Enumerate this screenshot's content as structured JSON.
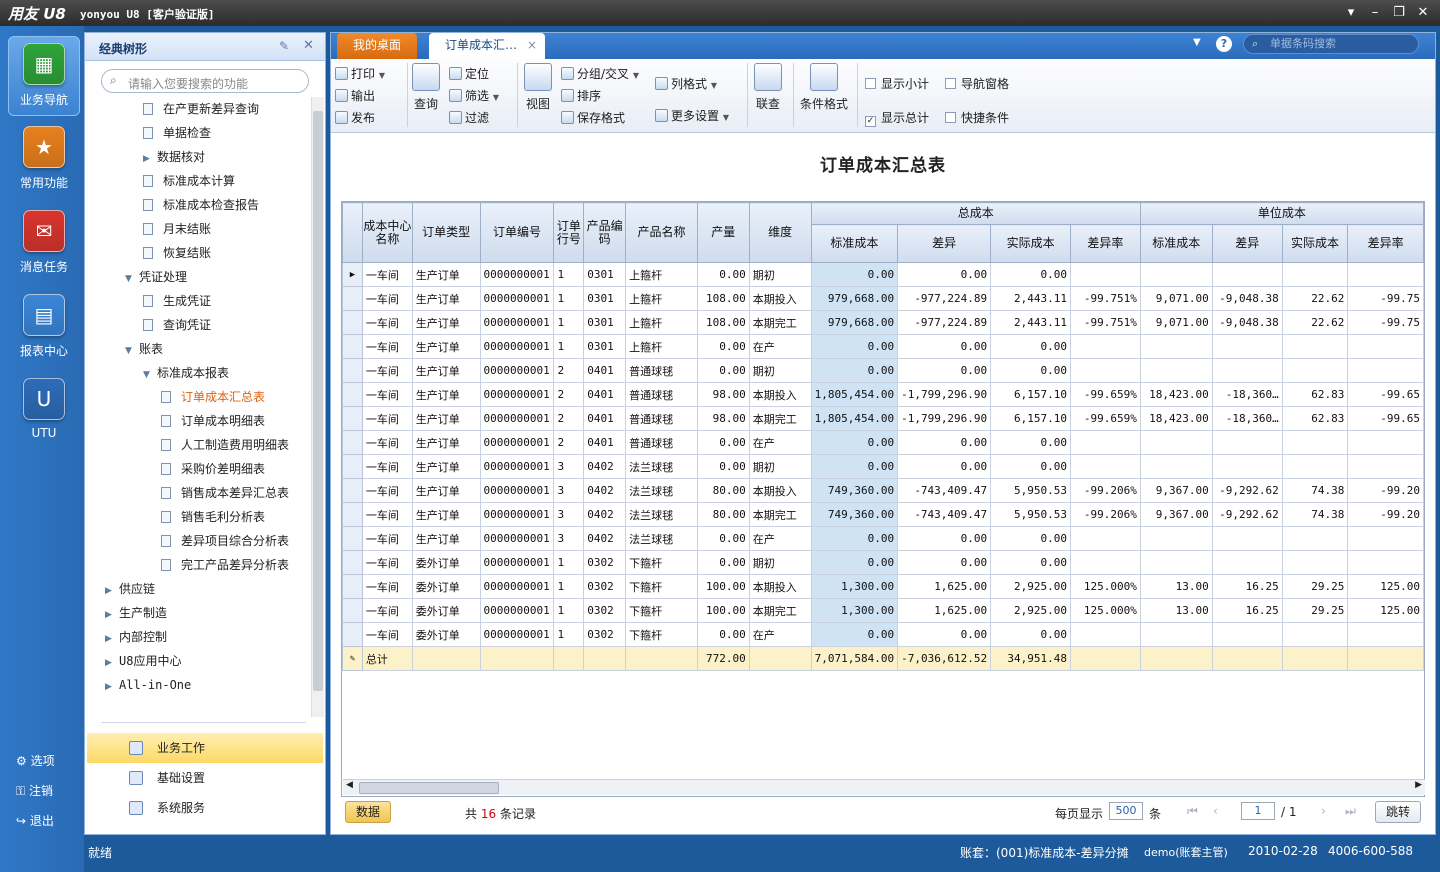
{
  "app": {
    "logo": "用友 U8",
    "title": "yonyou U8 [客户验证版]"
  },
  "modules": [
    {
      "label": "业务导航",
      "color": "#2fa33a"
    },
    {
      "label": "常用功能",
      "color": "#e7801f"
    },
    {
      "label": "消息任务",
      "color": "#d8352e"
    },
    {
      "label": "报表中心",
      "color": "#3a86d8"
    },
    {
      "label": "UTU",
      "color": "#2e6cb8"
    }
  ],
  "bottom_links": [
    {
      "label": "选项"
    },
    {
      "label": "注销"
    },
    {
      "label": "退出"
    }
  ],
  "nav": {
    "title": "经典树形",
    "search_placeholder": "请输入您要搜索的功能",
    "tree": [
      {
        "label": "在产更新差异查询",
        "kind": "doc",
        "level": 2
      },
      {
        "label": "单据检查",
        "kind": "doc",
        "level": 2
      },
      {
        "label": "数据核对",
        "kind": "folder",
        "level": 2,
        "arrow": "›"
      },
      {
        "label": "标准成本计算",
        "kind": "doc",
        "level": 2
      },
      {
        "label": "标准成本检查报告",
        "kind": "doc",
        "level": 2
      },
      {
        "label": "月末结账",
        "kind": "doc",
        "level": 2
      },
      {
        "label": "恢复结账",
        "kind": "doc",
        "level": 2
      },
      {
        "label": "凭证处理",
        "kind": "folder",
        "level": 1,
        "arrow": "⌄"
      },
      {
        "label": "生成凭证",
        "kind": "doc",
        "level": 2
      },
      {
        "label": "查询凭证",
        "kind": "doc",
        "level": 2
      },
      {
        "label": "账表",
        "kind": "folder",
        "level": 1,
        "arrow": "⌄"
      },
      {
        "label": "标准成本报表",
        "kind": "folder",
        "level": 2,
        "arrow": "⌄"
      },
      {
        "label": "订单成本汇总表",
        "kind": "doc",
        "level": 3,
        "active": true
      },
      {
        "label": "订单成本明细表",
        "kind": "doc",
        "level": 3
      },
      {
        "label": "人工制造费用明细表",
        "kind": "doc",
        "level": 3
      },
      {
        "label": "采购价差明细表",
        "kind": "doc",
        "level": 3
      },
      {
        "label": "销售成本差异汇总表",
        "kind": "doc",
        "level": 3
      },
      {
        "label": "销售毛利分析表",
        "kind": "doc",
        "level": 3
      },
      {
        "label": "差异项目综合分析表",
        "kind": "doc",
        "level": 3
      },
      {
        "label": "完工产品差异分析表",
        "kind": "doc",
        "level": 3
      },
      {
        "label": "供应链",
        "kind": "folder",
        "level": 0,
        "arrow": "›"
      },
      {
        "label": "生产制造",
        "kind": "folder",
        "level": 0,
        "arrow": "›"
      },
      {
        "label": "内部控制",
        "kind": "folder",
        "level": 0,
        "arrow": "›"
      },
      {
        "label": "U8应用中心",
        "kind": "folder",
        "level": 0,
        "arrow": "›"
      },
      {
        "label": "All-in-One",
        "kind": "folder",
        "level": 0,
        "arrow": "›"
      }
    ],
    "sections": [
      {
        "label": "业务工作",
        "selected": true
      },
      {
        "label": "基础设置",
        "selected": false
      },
      {
        "label": "系统服务",
        "selected": false
      }
    ]
  },
  "tabs": {
    "desktop": "我的桌面",
    "current": "订单成本汇…",
    "barcode_placeholder": "单据条码搜索"
  },
  "toolbar": {
    "print": "打印",
    "export": "输出",
    "publish": "发布",
    "query": "查询",
    "locate": "定位",
    "filter": "筛选",
    "filter2": "过滤",
    "view": "视图",
    "group": "分组/交叉",
    "sort": "排序",
    "save_format": "保存格式",
    "col_format": "列格式",
    "more_settings": "更多设置",
    "linked_query": "联查",
    "cond_format": "条件格式",
    "show_subtotal": "显示小计",
    "show_total": "显示总计",
    "nav_pane": "导航窗格",
    "quick_cond": "快捷条件",
    "show_subtotal_checked": false,
    "show_total_checked": true,
    "nav_pane_checked": false,
    "quick_cond_checked": false
  },
  "report": {
    "title": "订单成本汇总表",
    "group_headers": {
      "total_cost": "总成本",
      "unit_cost": "单位成本"
    },
    "columns": [
      "成本中心名称",
      "订单类型",
      "订单编号",
      "订单行号",
      "产品编码",
      "产品名称",
      "产量",
      "维度",
      "标准成本",
      "差异",
      "实际成本",
      "差异率",
      "标准成本",
      "差异",
      "实际成本",
      "差异率"
    ],
    "rows": [
      [
        "一车间",
        "生产订单",
        "0000000001",
        "1",
        "0301",
        "上箍杆",
        "0.00",
        "期初",
        "0.00",
        "0.00",
        "0.00",
        "",
        "",
        "",
        "",
        ""
      ],
      [
        "一车间",
        "生产订单",
        "0000000001",
        "1",
        "0301",
        "上箍杆",
        "108.00",
        "本期投入",
        "979,668.00",
        "-977,224.89",
        "2,443.11",
        "-99.751%",
        "9,071.00",
        "-9,048.38",
        "22.62",
        "-99.75"
      ],
      [
        "一车间",
        "生产订单",
        "0000000001",
        "1",
        "0301",
        "上箍杆",
        "108.00",
        "本期完工",
        "979,668.00",
        "-977,224.89",
        "2,443.11",
        "-99.751%",
        "9,071.00",
        "-9,048.38",
        "22.62",
        "-99.75"
      ],
      [
        "一车间",
        "生产订单",
        "0000000001",
        "1",
        "0301",
        "上箍杆",
        "0.00",
        "在产",
        "0.00",
        "0.00",
        "0.00",
        "",
        "",
        "",
        "",
        ""
      ],
      [
        "一车间",
        "生产订单",
        "0000000001",
        "2",
        "0401",
        "普通球毬",
        "0.00",
        "期初",
        "0.00",
        "0.00",
        "0.00",
        "",
        "",
        "",
        "",
        ""
      ],
      [
        "一车间",
        "生产订单",
        "0000000001",
        "2",
        "0401",
        "普通球毬",
        "98.00",
        "本期投入",
        "1,805,454.00",
        "-1,799,296.90",
        "6,157.10",
        "-99.659%",
        "18,423.00",
        "-18,360…",
        "62.83",
        "-99.65"
      ],
      [
        "一车间",
        "生产订单",
        "0000000001",
        "2",
        "0401",
        "普通球毬",
        "98.00",
        "本期完工",
        "1,805,454.00",
        "-1,799,296.90",
        "6,157.10",
        "-99.659%",
        "18,423.00",
        "-18,360…",
        "62.83",
        "-99.65"
      ],
      [
        "一车间",
        "生产订单",
        "0000000001",
        "2",
        "0401",
        "普通球毬",
        "0.00",
        "在产",
        "0.00",
        "0.00",
        "0.00",
        "",
        "",
        "",
        "",
        ""
      ],
      [
        "一车间",
        "生产订单",
        "0000000001",
        "3",
        "0402",
        "法兰球毬",
        "0.00",
        "期初",
        "0.00",
        "0.00",
        "0.00",
        "",
        "",
        "",
        "",
        ""
      ],
      [
        "一车间",
        "生产订单",
        "0000000001",
        "3",
        "0402",
        "法兰球毬",
        "80.00",
        "本期投入",
        "749,360.00",
        "-743,409.47",
        "5,950.53",
        "-99.206%",
        "9,367.00",
        "-9,292.62",
        "74.38",
        "-99.20"
      ],
      [
        "一车间",
        "生产订单",
        "0000000001",
        "3",
        "0402",
        "法兰球毬",
        "80.00",
        "本期完工",
        "749,360.00",
        "-743,409.47",
        "5,950.53",
        "-99.206%",
        "9,367.00",
        "-9,292.62",
        "74.38",
        "-99.20"
      ],
      [
        "一车间",
        "生产订单",
        "0000000001",
        "3",
        "0402",
        "法兰球毬",
        "0.00",
        "在产",
        "0.00",
        "0.00",
        "0.00",
        "",
        "",
        "",
        "",
        ""
      ],
      [
        "一车间",
        "委外订单",
        "0000000001",
        "1",
        "0302",
        "下箍杆",
        "0.00",
        "期初",
        "0.00",
        "0.00",
        "0.00",
        "",
        "",
        "",
        "",
        ""
      ],
      [
        "一车间",
        "委外订单",
        "0000000001",
        "1",
        "0302",
        "下箍杆",
        "100.00",
        "本期投入",
        "1,300.00",
        "1,625.00",
        "2,925.00",
        "125.000%",
        "13.00",
        "16.25",
        "29.25",
        "125.00"
      ],
      [
        "一车间",
        "委外订单",
        "0000000001",
        "1",
        "0302",
        "下箍杆",
        "100.00",
        "本期完工",
        "1,300.00",
        "1,625.00",
        "2,925.00",
        "125.000%",
        "13.00",
        "16.25",
        "29.25",
        "125.00"
      ],
      [
        "一车间",
        "委外订单",
        "0000000001",
        "1",
        "0302",
        "下箍杆",
        "0.00",
        "在产",
        "0.00",
        "0.00",
        "0.00",
        "",
        "",
        "",
        "",
        ""
      ]
    ],
    "total_row": [
      "总计",
      "",
      "",
      "",
      "",
      "",
      "772.00",
      "",
      "7,071,584.00",
      "-7,036,612.52",
      "34,951.48",
      "",
      "",
      "",
      "",
      ""
    ]
  },
  "pager": {
    "data_btn": "数据",
    "count_prefix": "共",
    "count": "16",
    "count_suffix": "条记录",
    "per_page_label": "每页显示",
    "per_page": "500",
    "per_page_unit": "条",
    "page": "1",
    "page_total": "/ 1",
    "jump": "跳转"
  },
  "status": {
    "ready": "就绪",
    "account": "账套：(001)标准成本-差异分摊",
    "user": "demo(账套主管)",
    "date": "2010-02-28",
    "phone": "4006-600-588"
  }
}
